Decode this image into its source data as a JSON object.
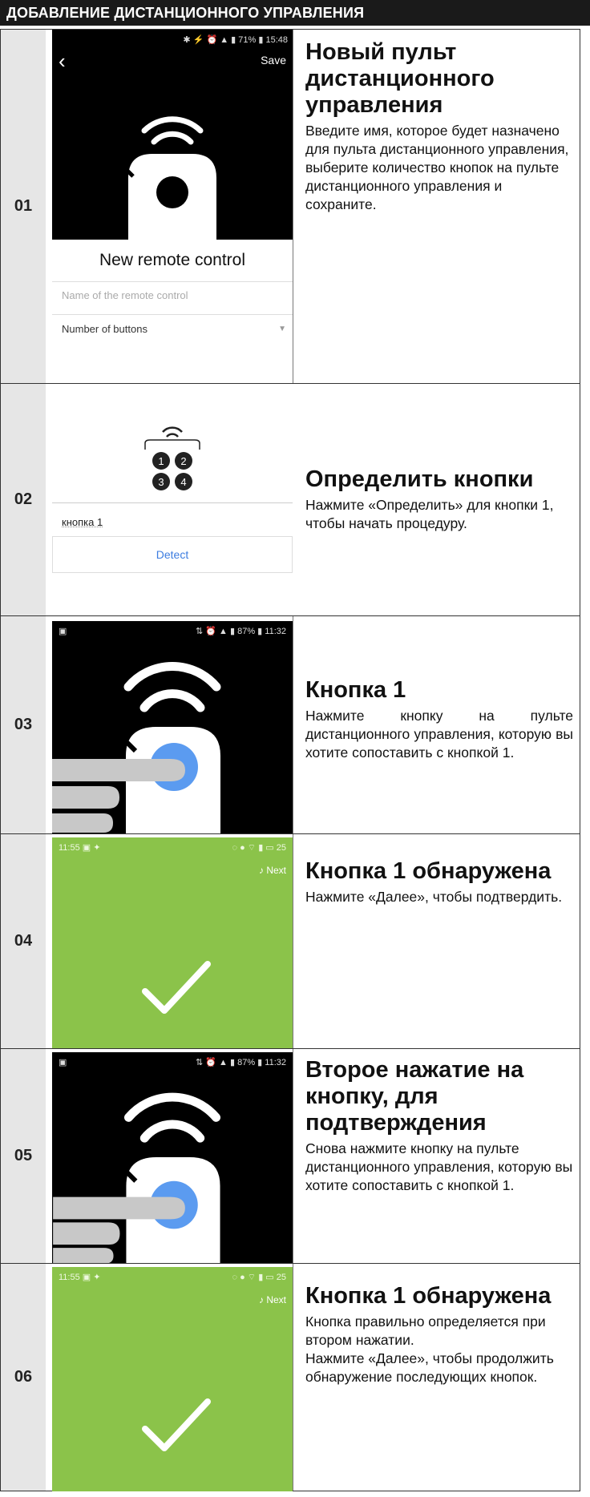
{
  "header": {
    "title": "ДОБАВЛЕНИЕ ДИСТАНЦИОННОГО УПРАВЛЕНИЯ"
  },
  "steps": [
    {
      "num": "01",
      "title": "Новый пульт дистанционного управления",
      "body": "Введите имя, которое будет назначено для пульта дистанционного управления, выберите количество кнопок на пульте дистанционного управления и сохраните.",
      "screen": {
        "status": "15:48",
        "battery": "71%",
        "save": "Save",
        "heading": "New remote control",
        "name_placeholder": "Name of the remote control",
        "buttons_label": "Number of buttons"
      }
    },
    {
      "num": "02",
      "title": "Определить кнопки",
      "body": "Нажмите «Определить» для кнопки 1, чтобы начать процедуру.",
      "screen": {
        "button_keys": [
          "1",
          "2",
          "3",
          "4"
        ],
        "field_value": "кнопка 1",
        "detect": "Detect"
      }
    },
    {
      "num": "03",
      "title": "Кнопка 1",
      "body": "Нажмите кнопку на пульте дистанционного управления, которую вы хотите сопоставить с кнопкой 1.",
      "screen": {
        "status": "11:32",
        "battery": "87%"
      }
    },
    {
      "num": "04",
      "title": "Кнопка 1 обнаружена",
      "body": "Нажмите «Далее», чтобы подтвердить.",
      "screen": {
        "status": "11:55",
        "battery": "25",
        "next": "Next"
      }
    },
    {
      "num": "05",
      "title": "Второе нажатие на кнопку, для подтверждения",
      "body": "Снова нажмите кнопку на пульте дистанционного управления, которую вы хотите сопоставить с кнопкой 1.",
      "screen": {
        "status": "11:32",
        "battery": "87%"
      }
    },
    {
      "num": "06",
      "title": "Кнопка 1 обнаружена",
      "body": "Кнопка правильно определяется при втором нажатии.",
      "body2": "Нажмите «Далее», чтобы продолжить обнаружение последующих кнопок.",
      "screen": {
        "status": "11:55",
        "battery": "25",
        "next": "Next"
      }
    }
  ],
  "colors": {
    "green": "#8bc34a",
    "blue": "#5b9bf0",
    "header": "#1a1a1a"
  }
}
